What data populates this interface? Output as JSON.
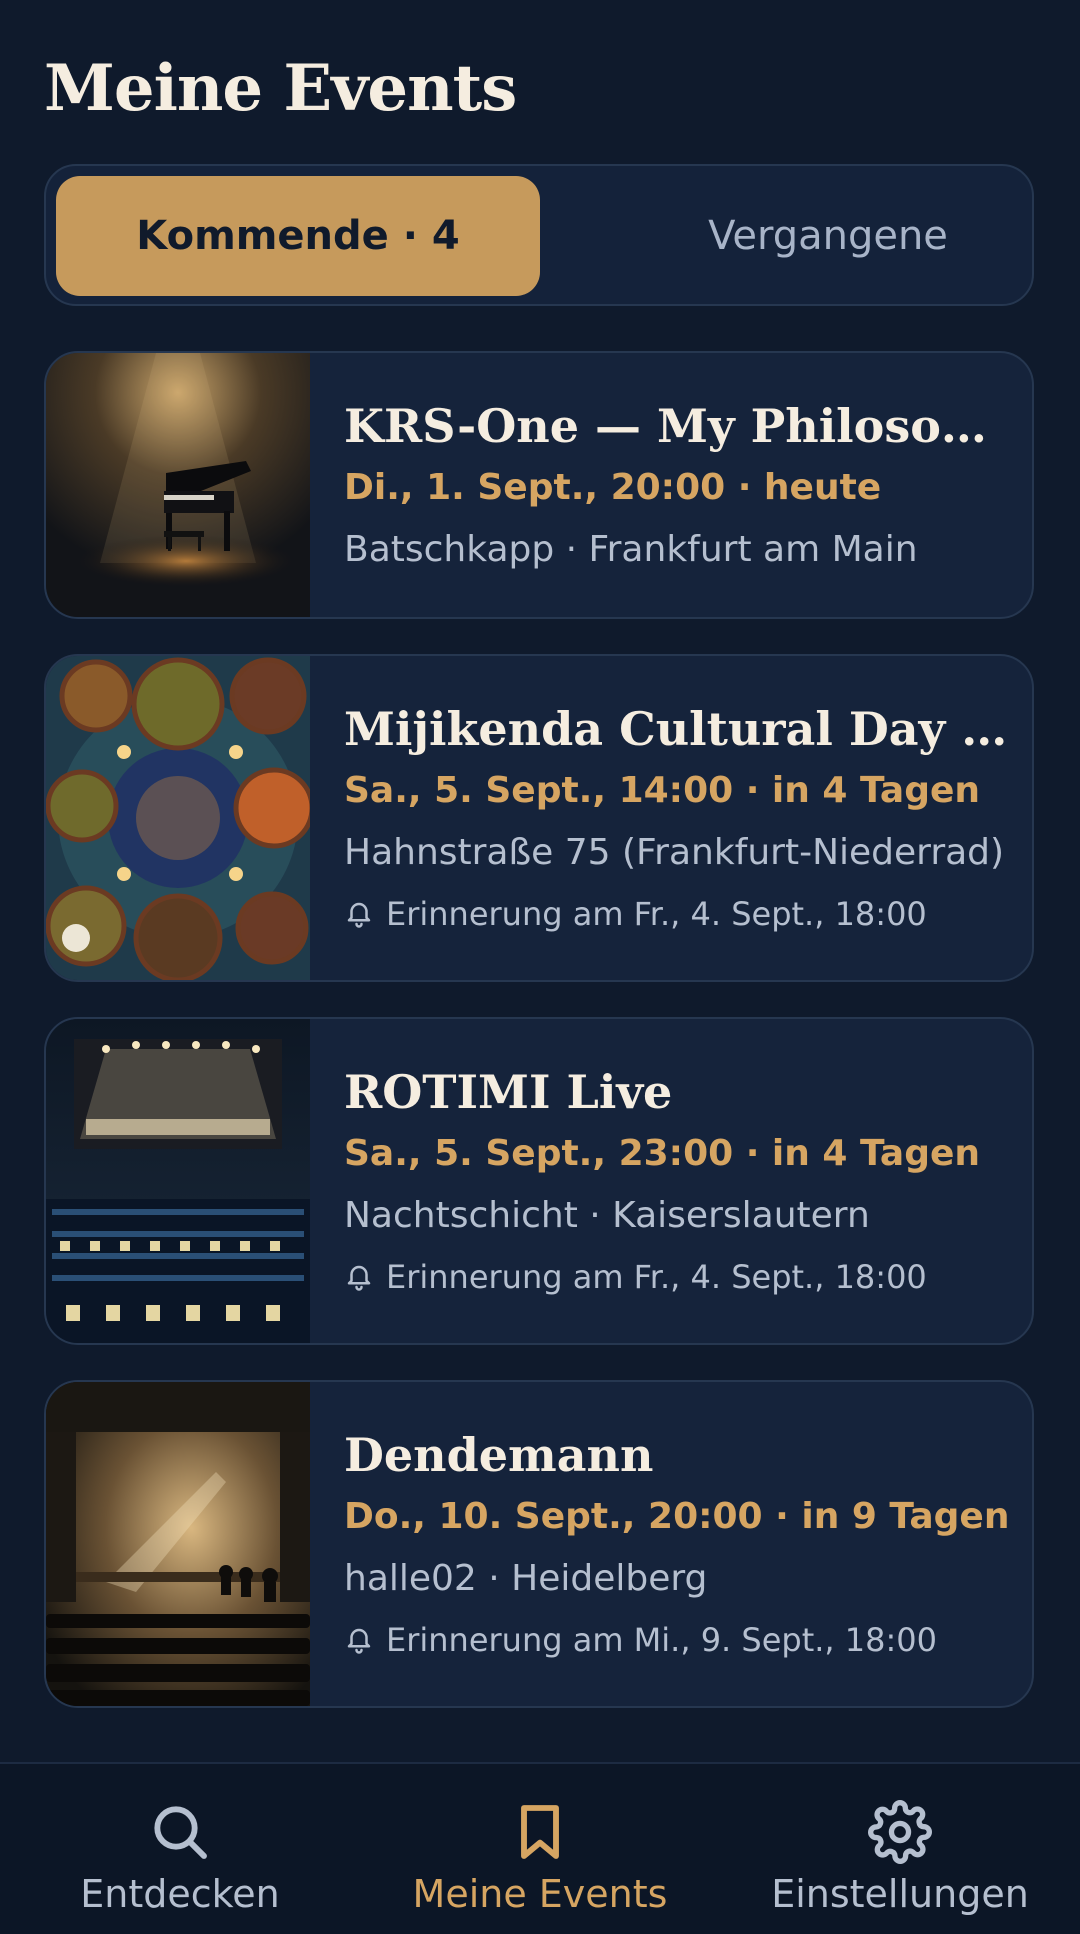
{
  "header": {
    "title": "Meine Events"
  },
  "tabs": {
    "upcoming": "Kommende · 4",
    "past": "Vergangene"
  },
  "events": [
    {
      "title": "KRS-One — My Philosophy",
      "datetime": "Di., 1. Sept., 20:00 · heute",
      "venue": "Batschkapp · Frankfurt am Main",
      "reminder": ""
    },
    {
      "title": "Mijikenda Cultural Day in Frankfurt",
      "datetime": "Sa., 5. Sept., 14:00 · in 4 Tagen",
      "venue": "Hahnstraße 75 (Frankfurt-Niederrad)",
      "reminder": "Erinnerung am Fr., 4. Sept., 18:00"
    },
    {
      "title": "ROTIMI Live",
      "datetime": "Sa., 5. Sept., 23:00 · in 4 Tagen",
      "venue": "Nachtschicht · Kaiserslautern",
      "reminder": "Erinnerung am Fr., 4. Sept., 18:00"
    },
    {
      "title": "Dendemann",
      "datetime": "Do., 10. Sept., 20:00 · in 9 Tagen",
      "venue": "halle02 · Heidelberg",
      "reminder": "Erinnerung am Mi., 9. Sept., 18:00"
    }
  ],
  "nav": [
    {
      "label": "Entdecken",
      "icon": "search-icon"
    },
    {
      "label": "Meine Events",
      "icon": "bookmark-icon"
    },
    {
      "label": "Einstellungen",
      "icon": "gear-icon"
    }
  ],
  "colors": {
    "background": "#0f1a2c",
    "card": "#15233b",
    "accent": "#c69a5c"
  }
}
